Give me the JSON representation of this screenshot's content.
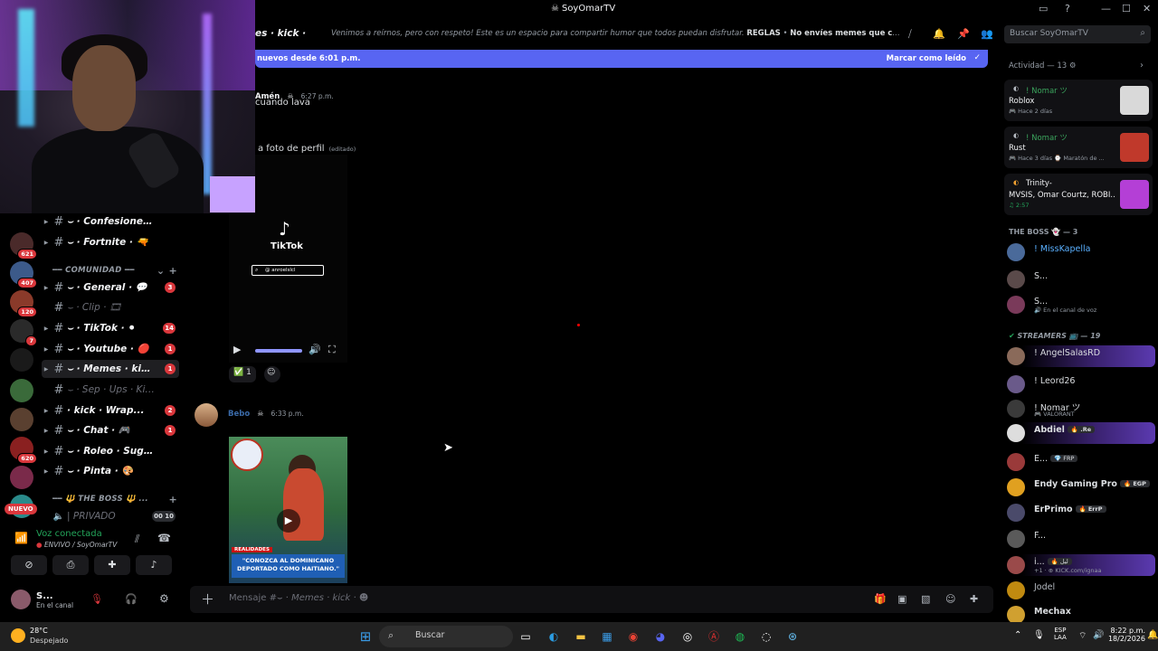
{
  "window": {
    "title": "SoyOmarTV",
    "title_icon": "discord-skull-icon"
  },
  "header": {
    "channel_name": "es · kick · ",
    "topic_prefix": "Venimos a reírnos, pero con respeto! Este es un espacio para compartir humor que todos puedan disfrutar. ",
    "topic_bold1": "REGLAS",
    "topic_bold2": "No envíes memes que contengan m...",
    "search_placeholder": "Buscar SoyOmarTV"
  },
  "newbar": {
    "left": "nuevos desde 6:01 p.m.",
    "right": "Marcar como leído"
  },
  "servers": {
    "badges": [
      "621",
      "407",
      "120",
      "7",
      "",
      "",
      "620",
      "",
      ""
    ],
    "new_label": "NUEVO"
  },
  "channels": {
    "items": [
      {
        "name": "⌣ · Confesiones · 🤫",
        "badge": "",
        "muted": false
      },
      {
        "name": "⌣ · Fortnite · 🔫",
        "badge": "",
        "muted": false
      },
      {
        "name": "⌣ · General · 💬",
        "badge": "3",
        "muted": false
      },
      {
        "name": "⌣ · Clip · 🎞",
        "badge": "",
        "muted": true
      },
      {
        "name": "⌣ · TikTok · ⚫",
        "badge": "14",
        "muted": false
      },
      {
        "name": "⌣ · Youtube · 🔴",
        "badge": "1",
        "muted": false
      },
      {
        "name": "⌣ · Memes · kick...",
        "badge": "1",
        "muted": false
      },
      {
        "name": "⌣ · Sep · Ups · Kick...",
        "badge": "",
        "muted": true
      },
      {
        "name": "· kick · Wrap...",
        "badge": "2",
        "muted": false
      },
      {
        "name": "⌣ · Chat · 🎮",
        "badge": "1",
        "muted": false
      },
      {
        "name": "⌣ · Roleo · Sugerido...",
        "badge": "",
        "muted": false
      },
      {
        "name": "⌣ · Pinta · 🎨",
        "badge": "",
        "muted": false
      }
    ],
    "category_comunidad": "━━ COMUNIDAD ━━",
    "category_boss": "━━ 🔱 THE BOSS 🔱 ...",
    "private_label": "| PRIVADO",
    "private_counts": "00  10"
  },
  "voice": {
    "status": "Voz conectada",
    "channel": "ENVIVO / SoyOmarTV"
  },
  "user": {
    "name": "S...",
    "status": "En el canal"
  },
  "messages": {
    "msg1_author": "Amén",
    "msg1_time": "6:27 p.m.",
    "msg1_text": "cuando lava",
    "msg1b_text": "a foto de perfil",
    "msg1b_edited": "(editado)",
    "tiktok_name": "TikTok",
    "tiktok_search": "@ anroelslcl",
    "reaction1_count": "1",
    "msg2_author": "Bebo",
    "msg2_time": "6:33 p.m.",
    "video2_tag": "REALIDADES",
    "video2_caption": "\"CONOZCA AL DOMINICANO DEPORTADO COMO HAITIANO.\""
  },
  "composer": {
    "placeholder_prefix": "Mensaje #⌣ · ",
    "placeholder_channel": "Memes · kick · "
  },
  "members": {
    "activity_header": "Actividad — 13",
    "activities": [
      {
        "name": "! Nomar ツ",
        "game": "Roblox",
        "sub": "🎮 Hace 2 días",
        "thumb_color": "#d9d9d9"
      },
      {
        "name": "! Nomar ツ",
        "game": "Rust",
        "sub": "🎮 Hace 3 días  ⌚ Maratón de ...",
        "thumb_color": "#c0392b"
      },
      {
        "name": "Trinity-",
        "game": "MVSIS, Omar Courtz, ROBI...",
        "sub": "♫ 2:57",
        "thumb_color": "#b43fd6"
      }
    ],
    "boss_header": "THE BOSS 👻 — 3",
    "boss": [
      {
        "name": "! MissKapella",
        "sub": "",
        "color": "#5ab0ff"
      },
      {
        "name": "S...",
        "sub": "",
        "color": "#dbdee1"
      },
      {
        "name": "S...",
        "sub": "🔊 En el canal de voz",
        "color": "#dbdee1"
      }
    ],
    "streamers_header": "STREAMERS 📺 — 19",
    "streamers": [
      {
        "name": "! AngelSalasRD",
        "sub": "",
        "tag": "",
        "color": "#f2f3f5"
      },
      {
        "name": "! Leord26",
        "sub": "",
        "tag": "",
        "color": "#f2f3f5"
      },
      {
        "name": "! Nomar ツ",
        "sub": "🎮 VALORANT",
        "tag": "",
        "color": "#f2f3f5"
      },
      {
        "name": "Abdiel",
        "sub": "",
        "tag": "🔥 .Re",
        "color": "#f2f3f5"
      },
      {
        "name": "E...",
        "sub": "",
        "tag": "💎 FRP",
        "color": "#f2f3f5"
      },
      {
        "name": "Endy Gaming Pro",
        "sub": "",
        "tag": "🔥 EGP",
        "color": "#f2f3f5"
      },
      {
        "name": "ErPrimo",
        "sub": "",
        "tag": "🔥 ErrP",
        "color": "#f2f3f5"
      },
      {
        "name": "F...",
        "sub": "",
        "tag": "",
        "color": "#f2f3f5"
      },
      {
        "name": "i...",
        "sub": "+1 · ⊕ KICK.com/ignaa",
        "tag": "🔥 ليل",
        "color": "#f2f3f5"
      },
      {
        "name": "Jodel",
        "sub": "",
        "tag": "",
        "color": "#b5bac1"
      },
      {
        "name": "Mechax",
        "sub": "",
        "tag": "",
        "color": "#f2f3f5"
      }
    ]
  },
  "taskbar": {
    "temp": "28°C",
    "weather": "Despejado",
    "search": "Buscar",
    "lang1": "ESP",
    "lang2": "LAA",
    "time": "8:22 p.m.",
    "date": "18/2/2026"
  }
}
